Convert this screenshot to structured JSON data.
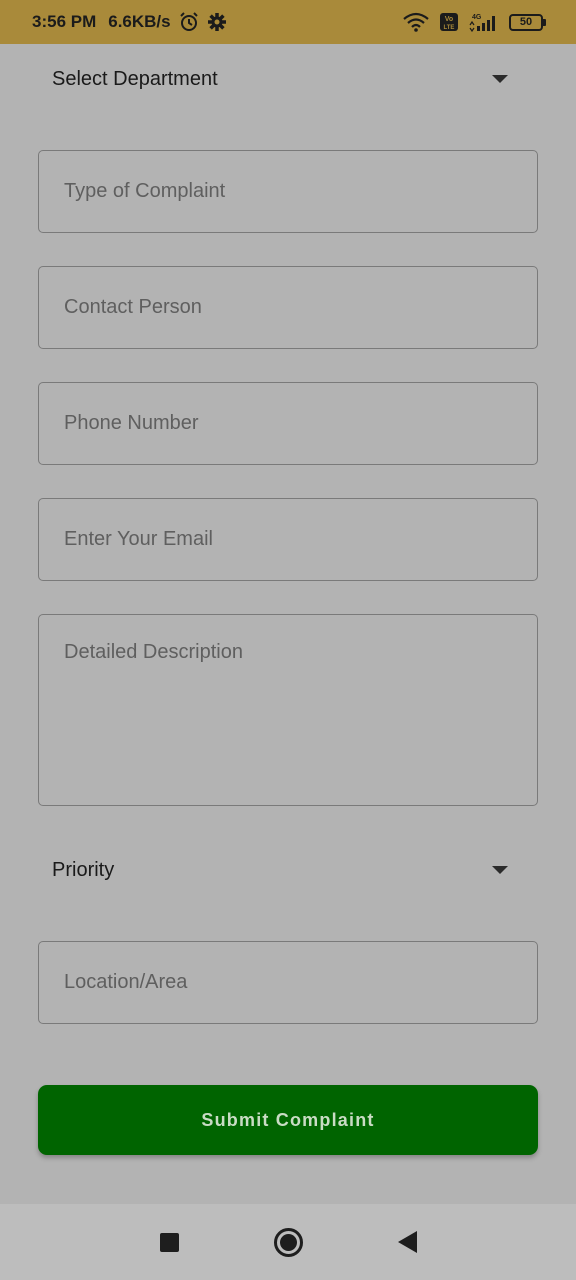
{
  "status_bar": {
    "time": "3:56 PM",
    "speed": "6.6KB/s",
    "network": "4G",
    "volte": "Vo LTE",
    "battery": "50"
  },
  "form": {
    "department_select": {
      "value": "Select Department"
    },
    "complaint_type": {
      "placeholder": "Type of Complaint"
    },
    "contact_person": {
      "placeholder": "Contact Person"
    },
    "phone_number": {
      "placeholder": "Phone Number"
    },
    "email": {
      "placeholder": "Enter Your Email"
    },
    "description": {
      "placeholder": "Detailed Description"
    },
    "priority_select": {
      "value": "Priority"
    },
    "location": {
      "placeholder": "Location/Area"
    },
    "submit_label": "Submit Complaint"
  },
  "colors": {
    "status_bar_bg": "#a98a3a",
    "page_bg": "#b3b3b3",
    "submit_bg": "#006400"
  }
}
